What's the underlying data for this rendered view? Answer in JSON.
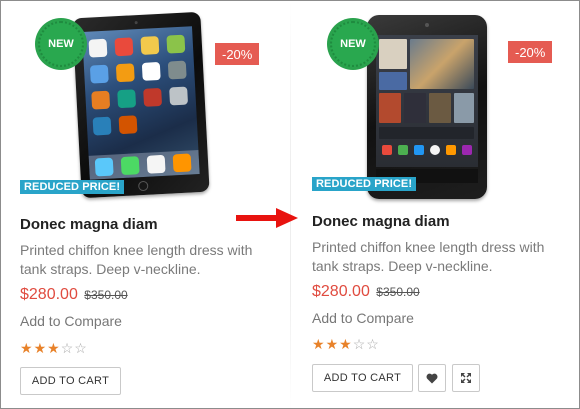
{
  "products": [
    {
      "badge_new": "NEW",
      "discount": "-20%",
      "reduced": "REDUCED PRICE!",
      "title": "Donec magna diam",
      "description": "Printed chiffon knee length dress with tank straps. Deep v-neckline.",
      "price": "$280.00",
      "old_price": "$350.00",
      "compare": "Add to Compare",
      "rating": 3,
      "rating_max": 5,
      "add_to_cart": "ADD TO CART",
      "image_icon": "ipad-tablet-image"
    },
    {
      "badge_new": "NEW",
      "discount": "-20%",
      "reduced": "REDUCED PRICE!",
      "title": "Donec magna diam",
      "description": "Printed chiffon knee length dress with tank straps. Deep v-neckline.",
      "price": "$280.00",
      "old_price": "$350.00",
      "compare": "Add to Compare",
      "rating": 3,
      "rating_max": 5,
      "add_to_cart": "ADD TO CART",
      "image_icon": "nexus-tablet-image",
      "wishlist_icon": "heart-icon",
      "quickview_icon": "expand-icon"
    }
  ],
  "annotation": {
    "icon": "red-arrow-icon",
    "color": "#e8130f"
  },
  "colors": {
    "new_badge": "#29a84f",
    "discount": "#e55b52",
    "reduced": "#29a4c9",
    "price": "#e04b3f",
    "star": "#e8822a"
  }
}
